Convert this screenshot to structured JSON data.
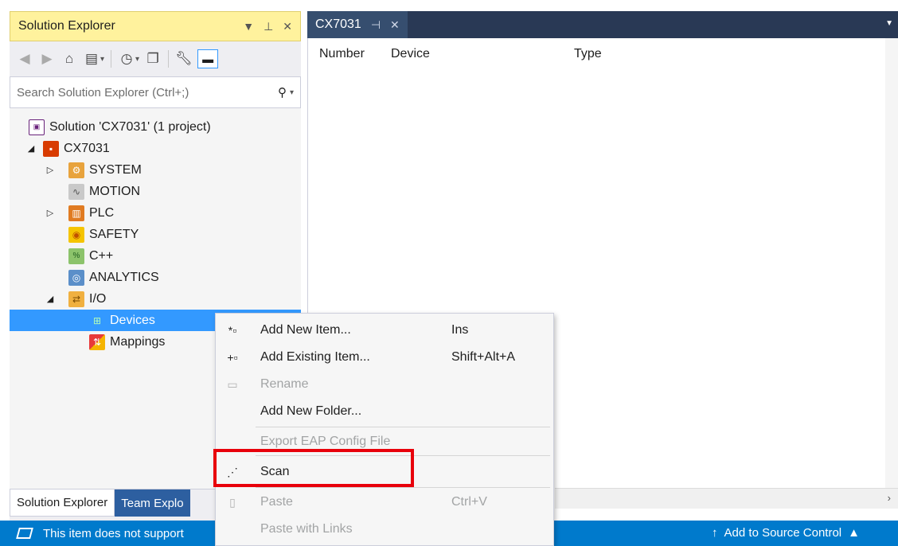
{
  "solution_explorer": {
    "title": "Solution Explorer",
    "title_controls": [
      "▾",
      "⊥",
      "✕"
    ],
    "search_placeholder": "Search Solution Explorer (Ctrl+;)",
    "tree": {
      "solution": "Solution 'CX7031' (1 project)",
      "project": "CX7031",
      "items": {
        "system": "SYSTEM",
        "motion": "MOTION",
        "plc": "PLC",
        "safety": "SAFETY",
        "cpp": "C++",
        "analytics": "ANALYTICS",
        "io": "I/O",
        "devices": "Devices",
        "mappings": "Mappings"
      }
    },
    "bottom_tabs": {
      "solution_explorer": "Solution Explorer",
      "team_explorer": "Team Explo"
    }
  },
  "editor": {
    "tab_title": "CX7031",
    "columns": {
      "number": "Number",
      "device": "Device",
      "type": "Type"
    }
  },
  "context_menu": {
    "add_new_item": {
      "label": "Add New Item...",
      "shortcut": "Ins"
    },
    "add_existing_item": {
      "label": "Add Existing Item...",
      "shortcut": "Shift+Alt+A"
    },
    "rename": {
      "label": "Rename"
    },
    "add_new_folder": {
      "label": "Add New Folder..."
    },
    "export_eap": {
      "label": "Export EAP Config File"
    },
    "scan": {
      "label": "Scan"
    },
    "paste": {
      "label": "Paste",
      "shortcut": "Ctrl+V"
    },
    "paste_with_links": {
      "label": "Paste with Links"
    }
  },
  "status_bar": {
    "message": "This item does not support",
    "source_control": "Add to Source Control"
  },
  "colors": {
    "accent": "#007acc",
    "selection": "#3399ff",
    "highlight_box": "#e8000b",
    "panel_title": "#fff29d"
  }
}
